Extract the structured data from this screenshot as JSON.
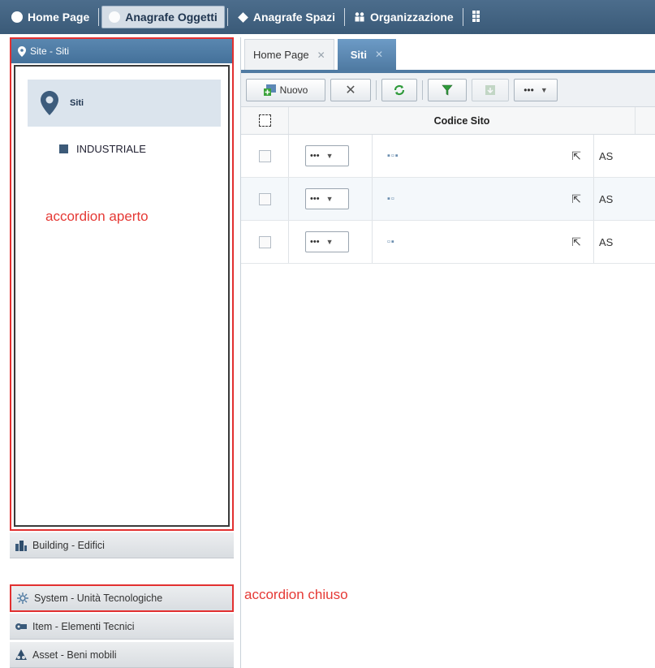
{
  "topnav": {
    "items": [
      {
        "label": "Home Page",
        "icon": "home-circle-icon",
        "active": false
      },
      {
        "label": "Anagrafe Oggetti",
        "icon": "objects-icon",
        "active": true
      },
      {
        "label": "Anagrafe Spazi",
        "icon": "diamond-icon",
        "active": false
      },
      {
        "label": "Organizzazione",
        "icon": "people-icon",
        "active": false
      }
    ]
  },
  "accordion": {
    "open": {
      "header": "Site - Siti",
      "card_label": "Siti",
      "tree_item": "INDUSTRIALE"
    },
    "closed": [
      {
        "label": "Building - Edifici",
        "icon": "building-icon"
      },
      {
        "label": "System - Unità Tecnologiche",
        "icon": "system-icon"
      },
      {
        "label": "Item - Elementi Tecnici",
        "icon": "item-icon"
      },
      {
        "label": "Asset - Beni mobili",
        "icon": "asset-icon"
      }
    ]
  },
  "annotations": {
    "open": "accordion aperto",
    "closed": "accordion chiuso"
  },
  "tabs": [
    {
      "label": "Home Page",
      "active": false
    },
    {
      "label": "Siti",
      "active": true
    }
  ],
  "toolbar": {
    "new_label": "Nuovo",
    "more_label": "•••"
  },
  "grid": {
    "column_header": "Codice Sito",
    "rows": [
      {
        "code": "▪▫▪",
        "menu": "•••",
        "trunc": "AS"
      },
      {
        "code": "▪▫",
        "menu": "•••",
        "trunc": "AS"
      },
      {
        "code": "▫▪",
        "menu": "•••",
        "trunc": "AS"
      }
    ]
  },
  "colors": {
    "accent": "#4f7aa2",
    "annotation": "#e53935",
    "nav_bg": "#3f6080"
  }
}
